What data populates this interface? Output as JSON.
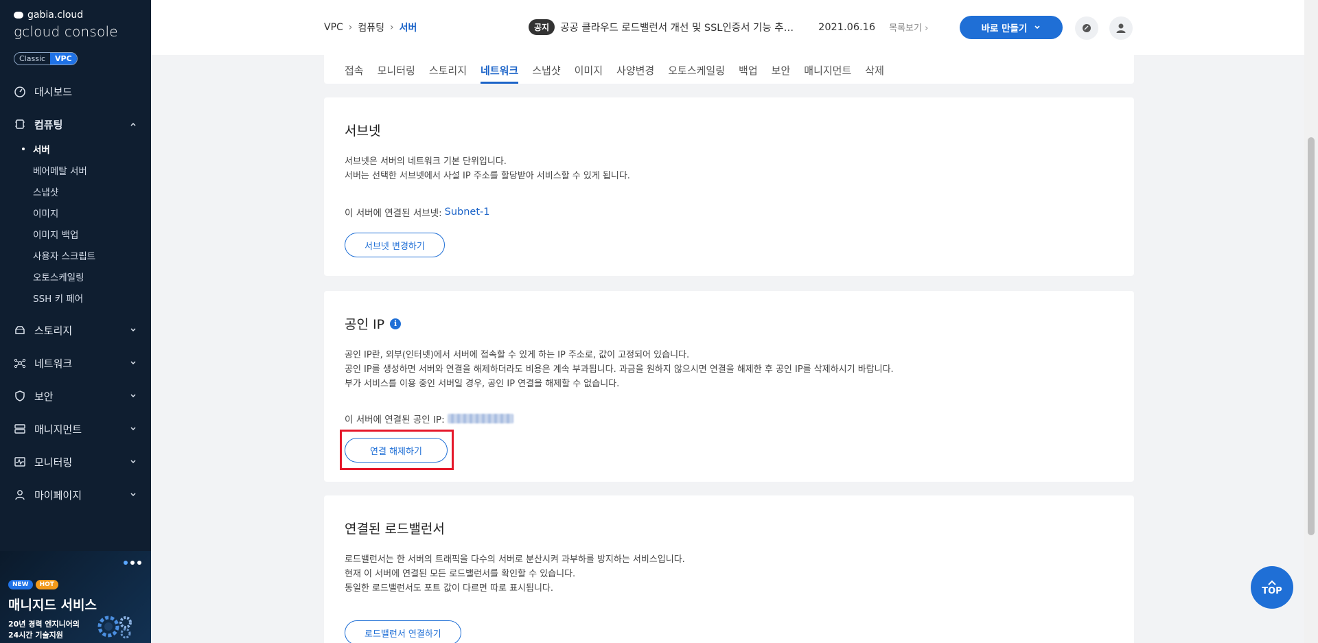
{
  "brand": {
    "company": "gabia.cloud",
    "console": "gcloud console"
  },
  "env_toggle": {
    "classic": "Classic",
    "vpc": "VPC"
  },
  "sidebar": {
    "dashboard": "대시보드",
    "computing": "컴퓨팅",
    "computing_items": [
      "서버",
      "베어메탈 서버",
      "스냅샷",
      "이미지",
      "이미지 백업",
      "사용자 스크립트",
      "오토스케일링",
      "SSH 키 페어"
    ],
    "storage": "스토리지",
    "network": "네트워크",
    "security": "보안",
    "management": "매니지먼트",
    "monitoring": "모니터링",
    "mypage": "마이페이지"
  },
  "promo": {
    "badge_new": "NEW",
    "badge_hot": "HOT",
    "title": "매니지드 서비스",
    "sub_line1": "20년 경력 엔지니어의",
    "sub_line2": "24시간 기술지원"
  },
  "breadcrumb": {
    "level1": "VPC",
    "level2": "컴퓨팅",
    "current": "서버"
  },
  "notice": {
    "tag": "공지",
    "text": "공공 클라우드 로드밸런서 개선 및 SSL인증서 기능 추…",
    "date": "2021.06.16",
    "more": "목록보기"
  },
  "header": {
    "create_label": "바로 만들기"
  },
  "tabs": [
    "접속",
    "모니터링",
    "스토리지",
    "네트워크",
    "스냅샷",
    "이미지",
    "사양변경",
    "오토스케일링",
    "백업",
    "보안",
    "매니지먼트",
    "삭제"
  ],
  "active_tab": "네트워크",
  "subnet": {
    "title": "서브넷",
    "desc1": "서브넷은 서버의 네트워크 기본 단위입니다.",
    "desc2": "서버는 선택한 서브넷에서 사설 IP 주소를 할당받아 서비스할 수 있게 됩니다.",
    "linked_label": "이 서버에 연결된 서브넷:",
    "linked_value": "Subnet-1",
    "button": "서브넷 변경하기"
  },
  "public_ip": {
    "title": "공인 IP",
    "desc1": "공인 IP란, 외부(인터넷)에서 서버에 접속할 수 있게 하는 IP 주소로, 값이 고정되어 있습니다.",
    "desc2": "공인 IP를 생성하면 서버와 연결을 해제하더라도 비용은 계속 부과됩니다. 과금을 원하지 않으시면 연결을 해제한 후 공인 IP를 삭제하시기 바랍니다.",
    "desc3": "부가 서비스를 이용 중인 서버일 경우, 공인 IP 연결을 해제할 수 없습니다.",
    "linked_label": "이 서버에 연결된 공인 IP:",
    "button": "연결 해제하기"
  },
  "load_balancer": {
    "title": "연결된 로드밸런서",
    "desc1": "로드밸런서는 한 서버의 트래픽을 다수의 서버로 분산시켜 과부하를 방지하는 서비스입니다.",
    "desc2": "현재 이 서버에 연결된 모든 로드밸런서를 확인할 수 있습니다.",
    "desc3": "동일한 로드밸런서도 포트 값이 다르면 따로 표시됩니다.",
    "button": "로드밸런서 연결하기"
  },
  "top_button": "TOP",
  "colors": {
    "accent": "#1f6fd6",
    "sidebar_bg": "#0f1e30",
    "highlight": "#e5182a"
  }
}
